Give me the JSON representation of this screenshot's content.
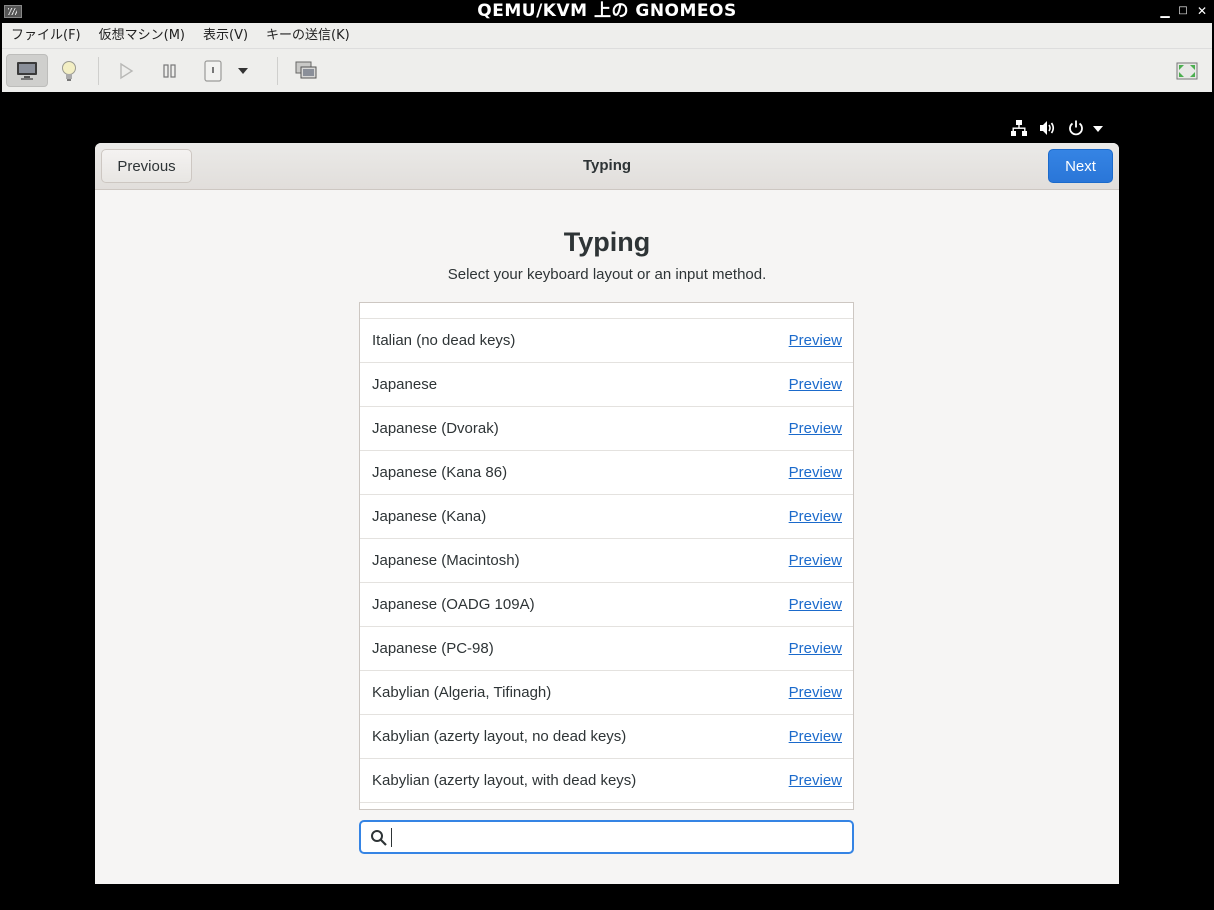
{
  "window": {
    "title": "QEMU/KVM 上の GNOMEOS",
    "minimize": "▁",
    "maximize": "□",
    "close": "✕"
  },
  "menubar": [
    {
      "label": "ファイル(F)"
    },
    {
      "label": "仮想マシン(M)"
    },
    {
      "label": "表示(V)"
    },
    {
      "label": "キーの送信(K)"
    }
  ],
  "toolbar": {
    "icons": [
      "console-icon",
      "details-lightbulb-icon",
      "run-icon",
      "pause-icon",
      "shutdown-icon",
      "shutdown-menu-chevron-icon",
      "snapshots-icon",
      "fullscreen-icon"
    ]
  },
  "guest_status_icons": [
    "network-icon",
    "volume-icon",
    "power-icon",
    "status-menu-chevron-icon"
  ],
  "dialog": {
    "header_title": "Typing",
    "previous_label": "Previous",
    "next_label": "Next",
    "heading": "Typing",
    "subheading": "Select your keyboard layout or an input method.",
    "accent_color": "#3584e4"
  },
  "layouts": [
    {
      "label": "Italian (no dead keys)",
      "link": "Preview"
    },
    {
      "label": "Japanese",
      "link": "Preview"
    },
    {
      "label": "Japanese (Dvorak)",
      "link": "Preview"
    },
    {
      "label": "Japanese (Kana 86)",
      "link": "Preview"
    },
    {
      "label": "Japanese (Kana)",
      "link": "Preview"
    },
    {
      "label": "Japanese (Macintosh)",
      "link": "Preview"
    },
    {
      "label": "Japanese (OADG 109A)",
      "link": "Preview"
    },
    {
      "label": "Japanese (PC-98)",
      "link": "Preview"
    },
    {
      "label": "Kabylian (Algeria, Tifinagh)",
      "link": "Preview"
    },
    {
      "label": "Kabylian (azerty layout, no dead keys)",
      "link": "Preview"
    },
    {
      "label": "Kabylian (azerty layout, with dead keys)",
      "link": "Preview"
    }
  ],
  "search": {
    "value": "",
    "placeholder": ""
  }
}
